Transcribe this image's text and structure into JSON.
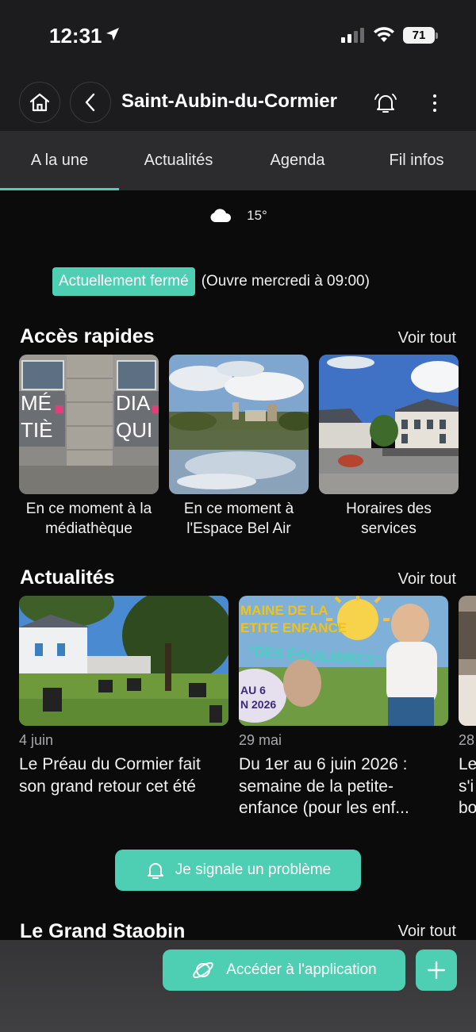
{
  "status_bar": {
    "time": "12:31",
    "battery": "71"
  },
  "header": {
    "title": "Saint-Aubin-du-Cormier"
  },
  "tabs": [
    {
      "label": "A la une",
      "active": true
    },
    {
      "label": "Actualités",
      "active": false
    },
    {
      "label": "Agenda",
      "active": false
    },
    {
      "label": "Fil infos",
      "active": false
    }
  ],
  "weather": {
    "temperature": "15°",
    "icon": "cloud-icon"
  },
  "opening": {
    "status": "Actuellement fermé",
    "detail": "(Ouvre mercredi à 09:00)"
  },
  "quick_access": {
    "title": "Accès rapides",
    "see_all": "Voir tout",
    "items": [
      {
        "label": "En ce moment à la médiathèque"
      },
      {
        "label": "En ce moment à l'Espace Bel Air"
      },
      {
        "label": "Horaires des services"
      }
    ]
  },
  "news": {
    "title": "Actualités",
    "see_all": "Voir tout",
    "items": [
      {
        "date": "4 juin",
        "title": "Le Préau du Cormier fait son grand retour cet été"
      },
      {
        "date": "29 mai",
        "title": "Du 1er au 6 juin 2026 : semaine de la petite-enfance (pour les enf..."
      },
      {
        "date": "28",
        "title": "Le s'i bo"
      }
    ]
  },
  "report_button": {
    "label": "Je signale un problème"
  },
  "grand_staobin": {
    "title": "Le Grand Staobin",
    "see_all": "Voir tout"
  },
  "bottom_bar": {
    "access_label": "Accéder à l'application"
  },
  "colors": {
    "accent": "#4ecfb4",
    "background": "#0b0b0c",
    "header": "#1c1c1e",
    "tabs": "#2c2c2e"
  }
}
